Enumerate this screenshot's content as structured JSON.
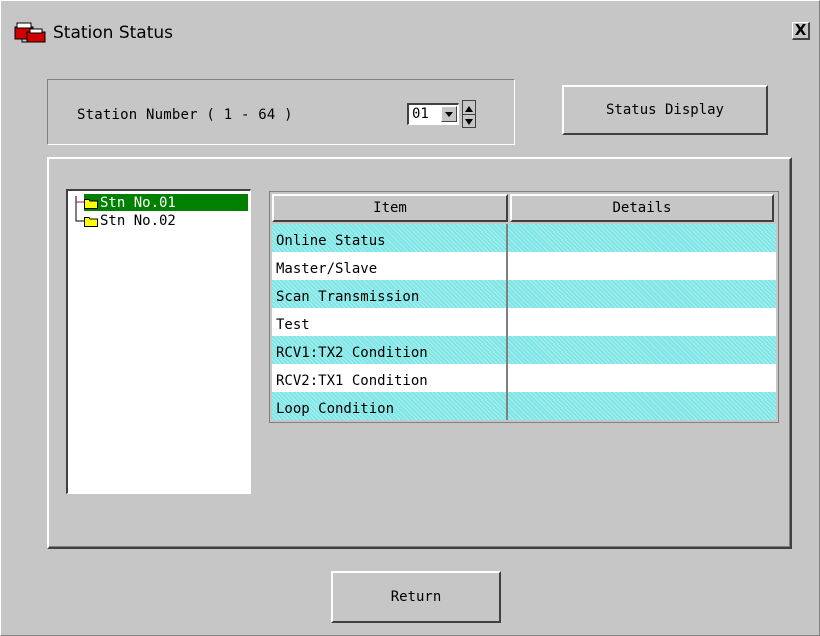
{
  "window": {
    "title": "Station Status",
    "close_label": "X"
  },
  "station": {
    "label": "Station Number ( 1 - 64 )",
    "selected": "01"
  },
  "status_button": "Status Display",
  "tree": {
    "items": [
      {
        "label": "Stn No.01",
        "selected": true
      },
      {
        "label": "Stn No.02",
        "selected": false
      }
    ]
  },
  "grid": {
    "headers": [
      "Item",
      "Details"
    ],
    "rows": [
      {
        "item": "Online Status",
        "details": ""
      },
      {
        "item": "Master/Slave",
        "details": ""
      },
      {
        "item": "Scan Transmission",
        "details": ""
      },
      {
        "item": "Test",
        "details": ""
      },
      {
        "item": "RCV1:TX2 Condition",
        "details": ""
      },
      {
        "item": "RCV2:TX1 Condition",
        "details": ""
      },
      {
        "item": "Loop Condition",
        "details": ""
      }
    ]
  },
  "return_button": "Return",
  "colors": {
    "selection": "#008000",
    "row_highlight": "#7fe6e6",
    "face": "#c6c6c6"
  },
  "icons": {
    "app": "station-status-icon",
    "folder": "folder-icon"
  }
}
